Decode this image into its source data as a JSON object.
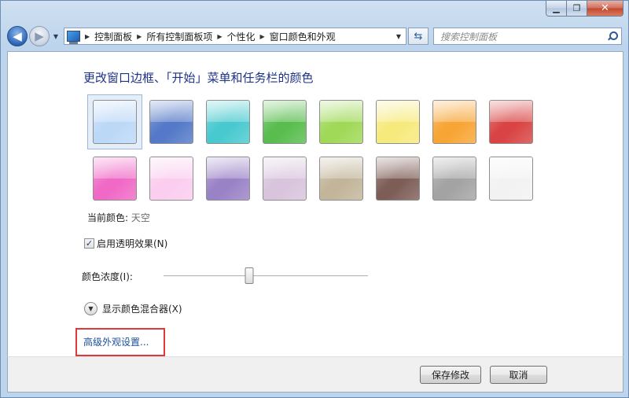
{
  "window": {
    "caption_buttons": {
      "minimize_glyph": "▁",
      "maximize_glyph": "❐",
      "close_glyph": "✕"
    }
  },
  "nav": {
    "back_glyph": "◀",
    "forward_glyph": "▶",
    "history_glyph": "▼",
    "breadcrumb_separator": "▶",
    "breadcrumbs": [
      "控制面板",
      "所有控制面板项",
      "个性化",
      "窗口颜色和外观"
    ],
    "dropdown_glyph": "▼",
    "refresh_glyph": "⇆",
    "search_placeholder": "搜索控制面板"
  },
  "main": {
    "title": "更改窗口边框、「开始」菜单和任务栏的颜色",
    "swatches_row1": [
      {
        "name": "天空",
        "color": "#bcd8f7",
        "selected": true
      },
      {
        "name": "twilight",
        "color": "#5479c8"
      },
      {
        "name": "sea",
        "color": "#48c9cf"
      },
      {
        "name": "leaf",
        "color": "#58bd4e"
      },
      {
        "name": "lime",
        "color": "#9fd957"
      },
      {
        "name": "banana",
        "color": "#f6ea7c"
      },
      {
        "name": "pumpkin",
        "color": "#f7a535"
      },
      {
        "name": "ruby",
        "color": "#d94343"
      }
    ],
    "swatches_row2": [
      {
        "name": "fuchsia",
        "color": "#f069c6"
      },
      {
        "name": "blush",
        "color": "#fbcdef"
      },
      {
        "name": "violet",
        "color": "#9a82c6"
      },
      {
        "name": "lavender",
        "color": "#d8c4dc"
      },
      {
        "name": "taupe",
        "color": "#c2b59a"
      },
      {
        "name": "chocolate",
        "color": "#7e5d57"
      },
      {
        "name": "slate",
        "color": "#a3a3a3"
      },
      {
        "name": "frost",
        "color": "#f2f2f2"
      }
    ],
    "current_color_label": "当前颜色:",
    "current_color_value": "天空",
    "transparency_checked": "✓",
    "transparency_label": "启用透明效果(N)",
    "intensity_label": "颜色浓度(I):",
    "intensity_value": 0.42,
    "mixer_glyph": "▼",
    "mixer_label": "显示颜色混合器(X)",
    "advanced_link": "高级外观设置..."
  },
  "footer": {
    "save_label": "保存修改",
    "cancel_label": "取消"
  }
}
